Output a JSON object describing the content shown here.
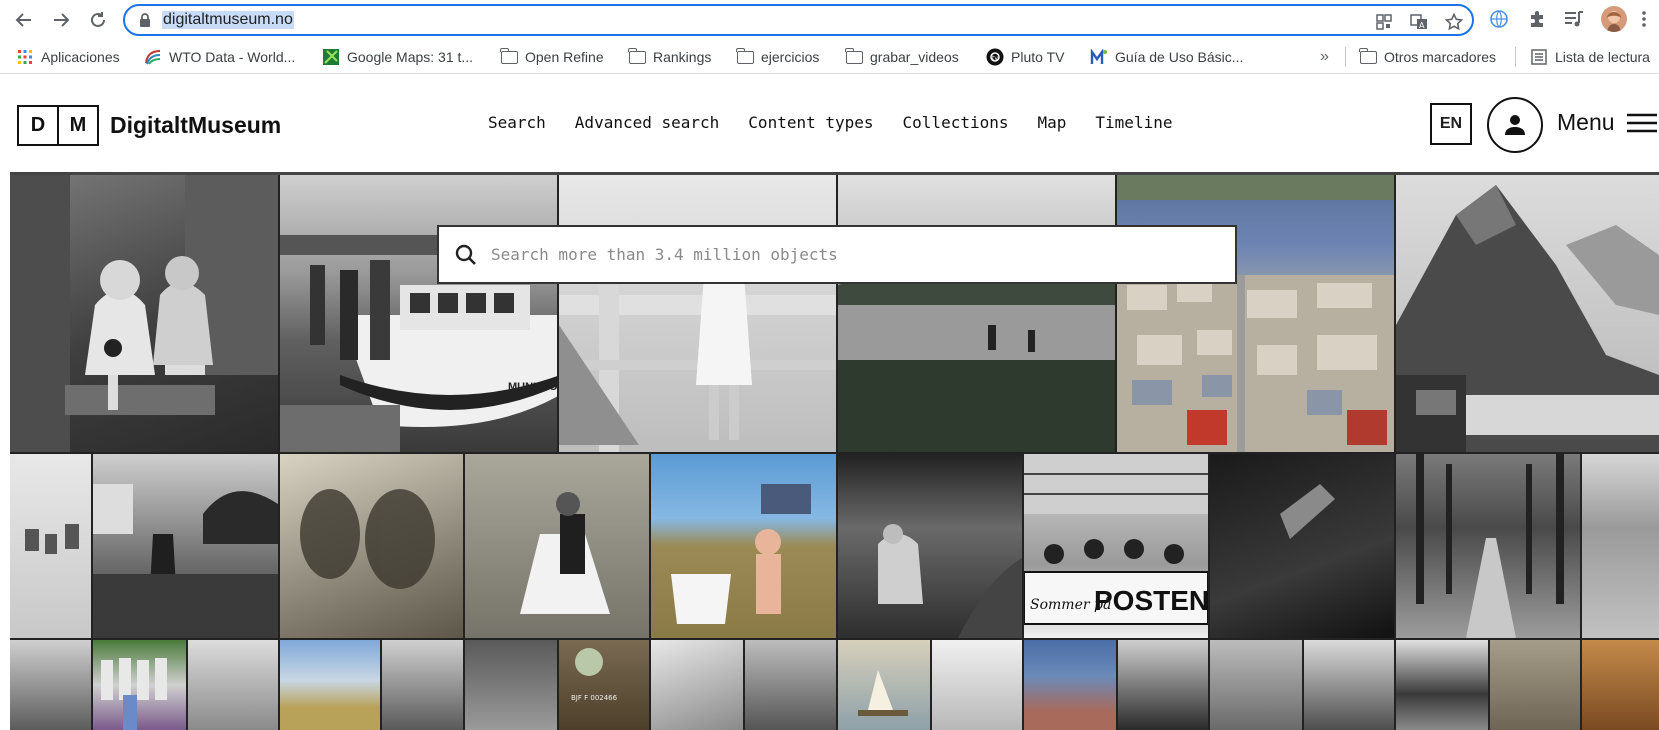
{
  "browser": {
    "url": "digitaltmuseum.no",
    "bookmarks": [
      {
        "label": "Aplicaciones",
        "icon": "apps-grid-icon"
      },
      {
        "label": "WTO Data - World...",
        "icon": "wto-logo-icon"
      },
      {
        "label": "Google Maps: 31 t...",
        "icon": "maps-icon"
      },
      {
        "label": "Open Refine",
        "icon": "folder-icon"
      },
      {
        "label": "Rankings",
        "icon": "folder-icon"
      },
      {
        "label": "ejercicios",
        "icon": "folder-icon"
      },
      {
        "label": "grabar_videos",
        "icon": "folder-icon"
      },
      {
        "label": "Pluto TV",
        "icon": "pluto-tv-icon"
      },
      {
        "label": "Guía de Uso Básic...",
        "icon": "m-logo-icon"
      },
      {
        "label": "Otros marcadores",
        "icon": "folder-icon"
      },
      {
        "label": "Lista de lectura",
        "icon": "reading-list-icon"
      }
    ],
    "overflow": "»"
  },
  "site": {
    "logo_letters": [
      "D",
      "M"
    ],
    "name": "DigitaltMuseum",
    "nav": [
      "Search",
      "Advanced search",
      "Content types",
      "Collections",
      "Map",
      "Timeline"
    ],
    "language": "EN",
    "menu_label": "Menu"
  },
  "search": {
    "placeholder": "Search more than 3.4 million objects"
  },
  "mosaic": {
    "caption_posten": "POSTEN",
    "caption_sommer": "Sommer på",
    "caption_boat": "MUNKHO",
    "caption_code": "BJF F 002466"
  }
}
